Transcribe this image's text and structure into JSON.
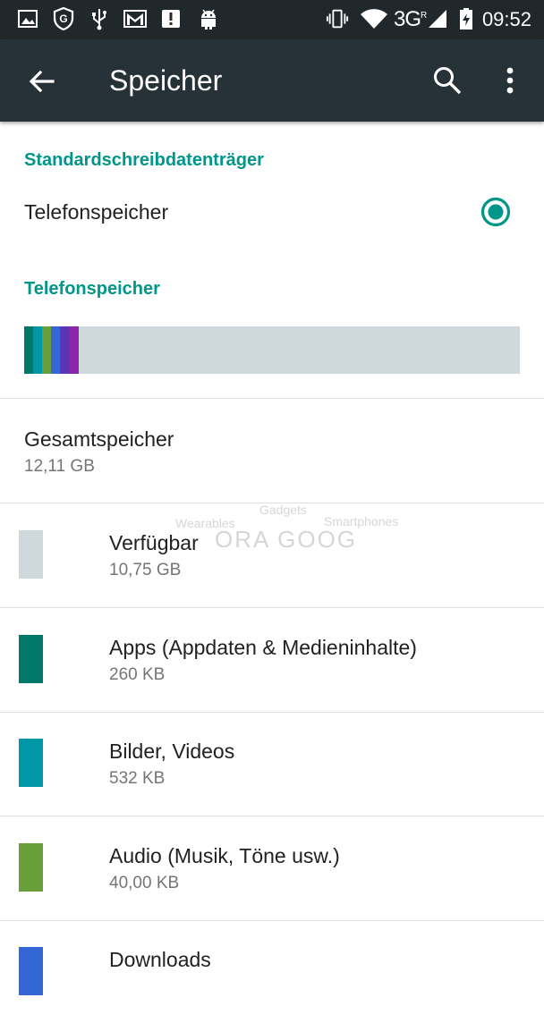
{
  "status_bar": {
    "time": "09:52",
    "network": "3G",
    "network_sup": "R",
    "notification_icons": [
      "image-icon",
      "shield-g-icon",
      "usb-icon",
      "gmail-icon",
      "alert-icon",
      "android-icon"
    ],
    "system_icons": [
      "vibrate-icon",
      "wifi-icon",
      "signal-icon",
      "battery-charging-icon"
    ]
  },
  "app_bar": {
    "title": "Speicher",
    "back_icon": "arrow-back-icon",
    "search_icon": "search-icon",
    "menu_icon": "more-vert-icon",
    "background": "#263238"
  },
  "default_write": {
    "header": "Standardschreibdatenträger",
    "option_label": "Telefonspeicher",
    "selected": true
  },
  "phone_storage": {
    "header": "Telefonspeicher",
    "usage_segments": [
      {
        "name": "Apps",
        "color": "#00796b",
        "fraction": 0.018
      },
      {
        "name": "Bilder, Videos",
        "color": "#0097a7",
        "fraction": 0.018
      },
      {
        "name": "Audio",
        "color": "#689f38",
        "fraction": 0.018
      },
      {
        "name": "Downloads",
        "color": "#3367d6",
        "fraction": 0.018
      },
      {
        "name": "Other1",
        "color": "#5e35b1",
        "fraction": 0.018
      },
      {
        "name": "Other2",
        "color": "#8e24aa",
        "fraction": 0.02
      }
    ],
    "free_color": "#cfd8dc"
  },
  "total": {
    "label": "Gesamtspeicher",
    "value": "12,11 GB"
  },
  "items": [
    {
      "label": "Verfügbar",
      "value": "10,75 GB",
      "color": "#cfd8dc"
    },
    {
      "label": "Apps (Appdaten & Medieninhalte)",
      "value": "260 KB",
      "color": "#00796b"
    },
    {
      "label": "Bilder, Videos",
      "value": "532 KB",
      "color": "#0097a7"
    },
    {
      "label": "Audio (Musik, Töne usw.)",
      "value": "40,00 KB",
      "color": "#689f38"
    },
    {
      "label": "Downloads",
      "value": "",
      "color": "#3367d6"
    }
  ],
  "watermark": {
    "line1": "Gadgets",
    "left": "Wearables",
    "right": "Smartphones",
    "main": "ORA GOOG"
  }
}
